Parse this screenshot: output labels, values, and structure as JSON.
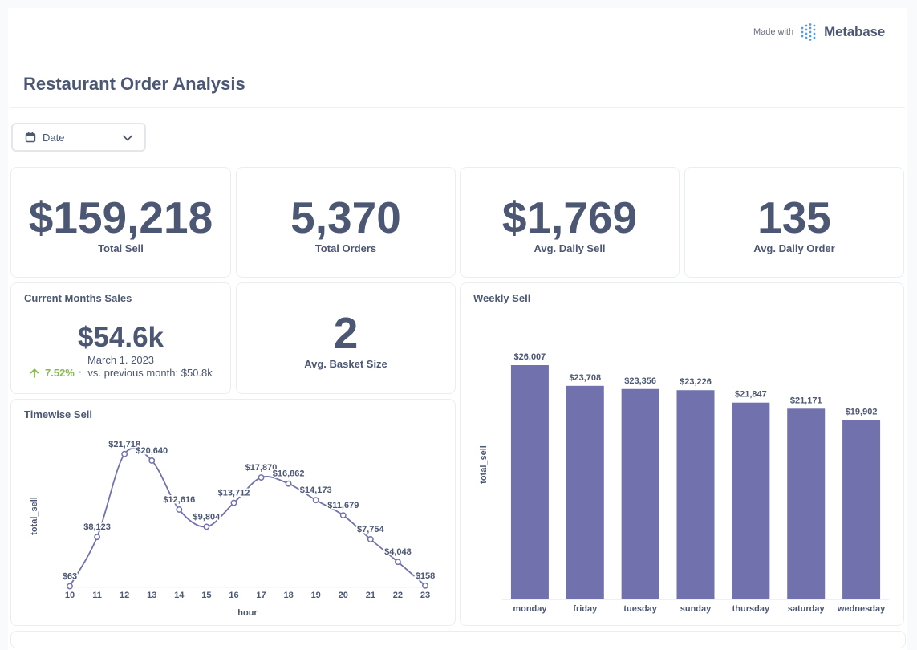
{
  "branding": {
    "made_with": "Made with",
    "name": "Metabase"
  },
  "dashboard": {
    "title": "Restaurant Order Analysis"
  },
  "filter": {
    "label": "Date"
  },
  "kpis": [
    {
      "value": "$159,218",
      "label": "Total Sell"
    },
    {
      "value": "5,370",
      "label": "Total Orders"
    },
    {
      "value": "$1,769",
      "label": "Avg. Daily Sell"
    },
    {
      "value": "135",
      "label": "Avg. Daily Order"
    }
  ],
  "current_month": {
    "title": "Current Months Sales",
    "value": "$54.6k",
    "date": "March 1. 2023",
    "change": "7.52%",
    "separator": "•",
    "comparison": "vs. previous month: $50.8k",
    "up_color": "#84bb4c"
  },
  "basket": {
    "value": "2",
    "label": "Avg. Basket Size"
  },
  "colors": {
    "line": "#7172ad",
    "bar": "#7172ad",
    "text": "#4c5773"
  },
  "timewise": {
    "title": "Timewise Sell",
    "chart_data": {
      "type": "line",
      "xlabel": "hour",
      "ylabel": "total_sell",
      "x": [
        "10",
        "11",
        "12",
        "13",
        "14",
        "15",
        "16",
        "17",
        "18",
        "19",
        "20",
        "21",
        "22",
        "23"
      ],
      "y": [
        63,
        8123,
        21718,
        20640,
        12616,
        9804,
        13712,
        17870,
        16862,
        14173,
        11679,
        7754,
        4048,
        158
      ],
      "data_labels": [
        "$63",
        "$8,123",
        "$21,718",
        "$20,640",
        "$12,616",
        "$9,804",
        "$13,712",
        "$17,870",
        "$16,862",
        "$14,173",
        "$11,679",
        "$7,754",
        "$4,048",
        "$158"
      ],
      "ylim": [
        0,
        23000
      ]
    }
  },
  "weekly": {
    "title": "Weekly Sell",
    "chart_data": {
      "type": "bar",
      "xlabel": "",
      "ylabel": "total_sell",
      "categories": [
        "monday",
        "friday",
        "tuesday",
        "sunday",
        "thursday",
        "saturday",
        "wednesday"
      ],
      "values": [
        26007,
        23708,
        23356,
        23226,
        21847,
        21171,
        19902
      ],
      "data_labels": [
        "$26,007",
        "$23,708",
        "$23,356",
        "$23,226",
        "$21,847",
        "$21,171",
        "$19,902"
      ],
      "ylim": [
        0,
        26007
      ]
    }
  }
}
